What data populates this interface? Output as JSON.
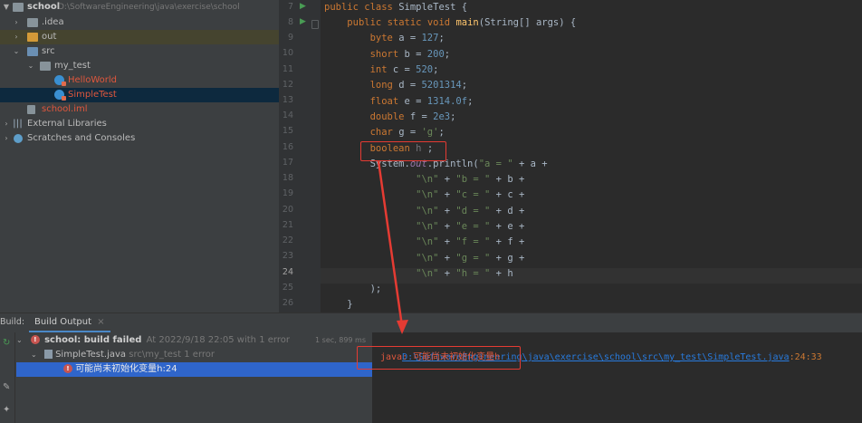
{
  "project_tree": {
    "root": {
      "name": "school",
      "path": "D:\\SoftwareEngineering\\java\\exercise\\school"
    },
    "items": [
      {
        "name": ".idea"
      },
      {
        "name": "out"
      },
      {
        "name": "src"
      },
      {
        "name": "my_test"
      },
      {
        "name": "HelloWorld"
      },
      {
        "name": "SimpleTest"
      },
      {
        "name": "school.iml"
      },
      {
        "name": "External Libraries"
      },
      {
        "name": "Scratches and Consoles"
      }
    ]
  },
  "editor": {
    "line_numbers": [
      "7",
      "8",
      "9",
      "10",
      "11",
      "12",
      "13",
      "14",
      "15",
      "16",
      "17",
      "18",
      "19",
      "20",
      "21",
      "22",
      "23",
      "24",
      "25",
      "26"
    ],
    "current_line": "24",
    "lines": [
      "public class SimpleTest {",
      "    public static void main(String[] args) {",
      "        byte a = 127;",
      "        short b = 200;",
      "        int c = 520;",
      "        long d = 5201314;",
      "        float e = 1314.0f;",
      "        double f = 2e3;",
      "        char g = 'g';",
      "        boolean h ;",
      "        System.out.println(\"a = \" + a +",
      "                \"\\n\" + \"b = \" + b +",
      "                \"\\n\" + \"c = \" + c +",
      "                \"\\n\" + \"d = \" + d +",
      "                \"\\n\" + \"e = \" + e +",
      "                \"\\n\" + \"f = \" + f +",
      "                \"\\n\" + \"g = \" + g +",
      "                \"\\n\" + \"h = \" + h",
      "        );",
      "    }"
    ]
  },
  "build": {
    "tab_prefix": "Build:",
    "tab_label": "Build Output",
    "tab_close": "×",
    "tree": {
      "root_label": "school: build failed",
      "root_detail": "At 2022/9/18 22:05 with 1 error",
      "root_time": "1 sec, 899 ms",
      "file_label": "SimpleTest.java",
      "file_detail": "src\\my_test 1 error",
      "error_label": "可能尚未初始化变量h",
      "error_pos": ":24"
    },
    "console": {
      "path_link": "D:\\SoftwareEngineering\\java\\exercise\\school\\src\\my_test\\SimpleTest.java",
      "path_pos": ":24:33",
      "message": "java: 可能尚未初始化变量h"
    }
  },
  "colors": {
    "annotation": "#e53b33",
    "error": "#c75450",
    "link": "#287bde",
    "keyword": "#cc7832",
    "number": "#6897bb",
    "string": "#6a8759"
  }
}
